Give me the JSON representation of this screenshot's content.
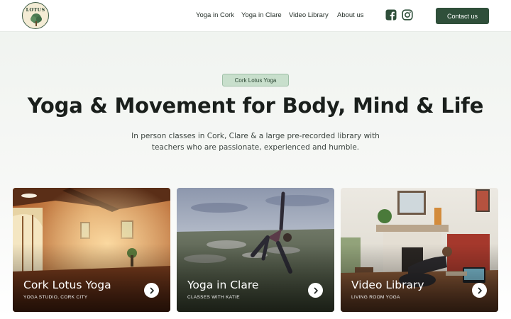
{
  "header": {
    "logo_text": "LOTUS",
    "nav": [
      {
        "label": "Yoga in Cork"
      },
      {
        "label": "Yoga in Clare"
      },
      {
        "label": "Video Library"
      },
      {
        "label": "About us"
      }
    ],
    "social_icons": [
      "facebook-icon",
      "instagram-icon"
    ],
    "contact_label": "Contact us"
  },
  "hero": {
    "badge": "Cork Lotus Yoga",
    "title": "Yoga & Movement for Body, Mind & Life",
    "subtitle_line1": "In person classes in Cork, Clare & a large pre-recorded library with",
    "subtitle_line2": "teachers who are passionate, experienced and humble."
  },
  "cards": [
    {
      "title": "Cork Lotus Yoga",
      "subtitle": "YOGA STUDIO, CORK CITY",
      "icon": "chevron-right-icon"
    },
    {
      "title": "Yoga in Clare",
      "subtitle": "CLASSES WITH KATIE",
      "icon": "chevron-right-icon"
    },
    {
      "title": "Video Library",
      "subtitle": "LIVING ROOM YOGA",
      "icon": "chevron-right-icon"
    }
  ],
  "colors": {
    "brand_green": "#2f4f3a",
    "badge_bg": "#c8dfcc",
    "page_bg": "#f3f6f2"
  }
}
